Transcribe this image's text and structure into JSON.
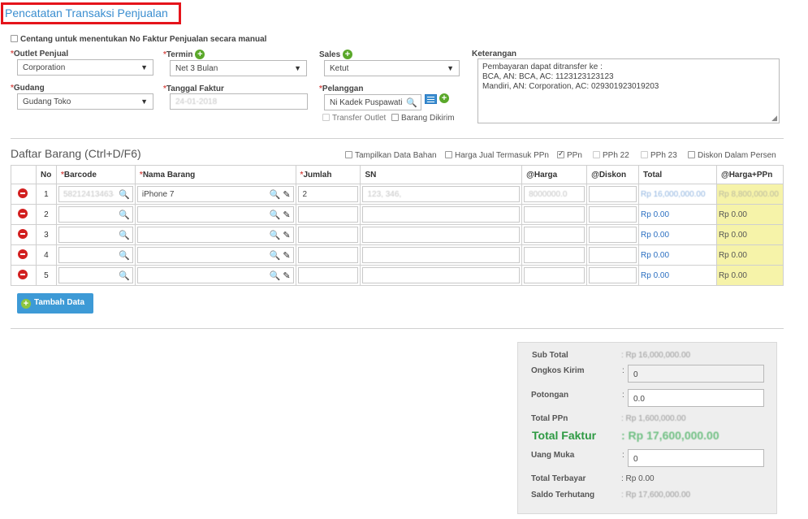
{
  "page": {
    "title": "Pencatatan Transaksi Penjualan"
  },
  "manual_checkbox_label": "Centang untuk menentukan No Faktur Penjualan secara manual",
  "form": {
    "outlet": {
      "label": "Outlet Penjual",
      "value": "Corporation"
    },
    "termin": {
      "label": "Termin",
      "value": "Net 3 Bulan"
    },
    "sales": {
      "label": "Sales",
      "value": "Ketut"
    },
    "keterangan": {
      "label": "Keterangan",
      "lines": [
        "Pembayaran dapat ditransfer ke :",
        "BCA, AN: BCA, AC: 1123123123123",
        "Mandiri, AN: Corporation, AC: 029301923019203"
      ]
    },
    "gudang": {
      "label": "Gudang",
      "value": "Gudang Toko"
    },
    "tanggal": {
      "label": "Tanggal Faktur",
      "value": "24-01-2018"
    },
    "pelanggan": {
      "label": "Pelanggan",
      "value": "Ni Kadek Puspawati"
    },
    "transfer_outlet": "Transfer Outlet",
    "barang_dikirim": "Barang Dikirim"
  },
  "daftar": {
    "title": "Daftar Barang (Ctrl+D/F6)",
    "options": [
      {
        "label": "Tampilkan Data Bahan",
        "checked": false
      },
      {
        "label": "Harga Jual Termasuk PPn",
        "checked": false
      },
      {
        "label": "PPn",
        "checked": true
      },
      {
        "label": "PPh 22",
        "checked": false
      },
      {
        "label": "PPh 23",
        "checked": false
      },
      {
        "label": "Diskon Dalam Persen",
        "checked": false
      }
    ],
    "headers": {
      "no": "No",
      "barcode": "Barcode",
      "nama": "Nama Barang",
      "jumlah": "Jumlah",
      "sn": "SN",
      "harga": "@Harga",
      "diskon": "@Diskon",
      "total": "Total",
      "hargappn": "@Harga+PPn"
    },
    "rows": [
      {
        "no": "1",
        "barcode": "582124134634",
        "nama": "iPhone 7",
        "jumlah": "2",
        "sn": "123, 346,",
        "harga": "8000000.0",
        "diskon": "",
        "total": "Rp 16,000,000.00",
        "hargappn": "Rp 8,800,000.00"
      },
      {
        "no": "2",
        "barcode": "",
        "nama": "",
        "jumlah": "",
        "sn": "",
        "harga": "",
        "diskon": "",
        "total": "Rp 0.00",
        "hargappn": "Rp 0.00"
      },
      {
        "no": "3",
        "barcode": "",
        "nama": "",
        "jumlah": "",
        "sn": "",
        "harga": "",
        "diskon": "",
        "total": "Rp 0.00",
        "hargappn": "Rp 0.00"
      },
      {
        "no": "4",
        "barcode": "",
        "nama": "",
        "jumlah": "",
        "sn": "",
        "harga": "",
        "diskon": "",
        "total": "Rp 0.00",
        "hargappn": "Rp 0.00"
      },
      {
        "no": "5",
        "barcode": "",
        "nama": "",
        "jumlah": "",
        "sn": "",
        "harga": "",
        "diskon": "",
        "total": "Rp 0.00",
        "hargappn": "Rp 0.00"
      }
    ],
    "tambah_label": "Tambah Data"
  },
  "summary": {
    "sub_total": {
      "label": "Sub Total",
      "value": ": Rp 16,000,000.00"
    },
    "ongkos": {
      "label": "Ongkos Kirim",
      "value": "0"
    },
    "potongan": {
      "label": "Potongan",
      "value": "0.0"
    },
    "total_ppn": {
      "label": "Total PPn",
      "value": ": Rp 1,600,000.00"
    },
    "total_faktur": {
      "label": "Total Faktur",
      "value": ": Rp 17,600,000.00"
    },
    "uang_muka": {
      "label": "Uang Muka",
      "value": "0"
    },
    "total_terbayar": {
      "label": "Total Terbayar",
      "value": ": Rp 0.00"
    },
    "saldo": {
      "label": "Saldo Terhutang",
      "value": ": Rp 17,600,000.00"
    }
  }
}
